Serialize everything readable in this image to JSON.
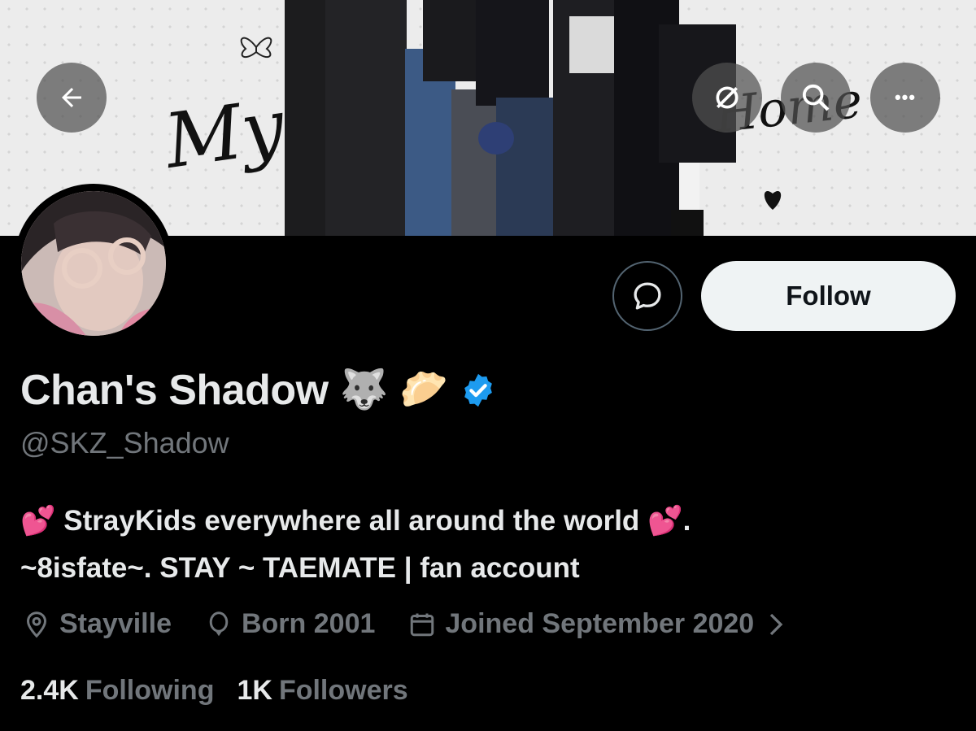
{
  "banner": {
    "script_word_left": "My",
    "script_word_right": "Home"
  },
  "header": {
    "back_icon": "arrow-left-icon",
    "sync_icon": "sync-off-icon",
    "search_icon": "search-icon",
    "more_icon": "more-horizontal-icon",
    "more_label": "•••"
  },
  "actions": {
    "message_icon": "message-icon",
    "follow_label": "Follow"
  },
  "profile": {
    "display_name": "Chan's Shadow",
    "name_emoji_1": "🐺",
    "name_emoji_2": "🥟",
    "verified_icon": "verified-badge-icon",
    "handle": "@SKZ_Shadow",
    "bio_line_1": "💕 StrayKids everywhere all around the world 💕.",
    "bio_line_2": "~8isfate~. STAY ~ TAEMATE | fan account",
    "location": "Stayville",
    "birth": "Born 2001",
    "joined": "Joined September 2020"
  },
  "stats": {
    "following_count": "2.4K",
    "following_label": "Following",
    "followers_count": "1K",
    "followers_label": "Followers"
  },
  "colors": {
    "background": "#000000",
    "text_primary": "#e7e9ea",
    "text_secondary": "#71767b",
    "follow_button_bg": "#eff3f4",
    "verified_blue": "#1d9bf0"
  }
}
